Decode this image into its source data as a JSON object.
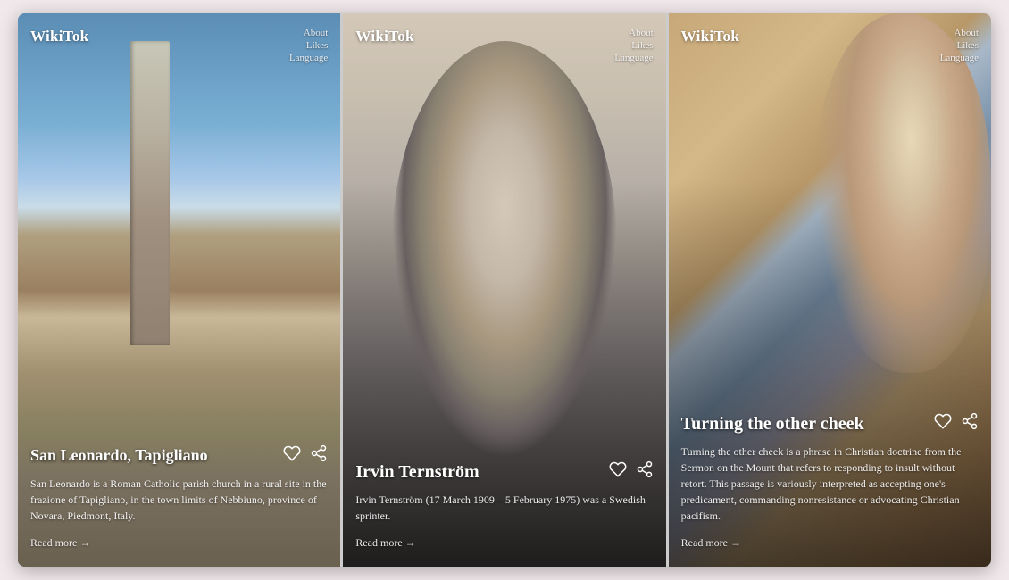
{
  "brand": "WikiTok",
  "nav": [
    "About",
    "Likes",
    "Language"
  ],
  "cards": [
    {
      "id": "card-1",
      "title": "San Leonardo, Tapigliano",
      "description": "San Leonardo is a Roman Catholic parish church in a rural site in the frazione of Tapigliano, in the town limits of Nebbiuno, province of Novara, Piedmont, Italy.",
      "read_more": "Read more →"
    },
    {
      "id": "card-2",
      "title": "Irvin Ternström",
      "description": "Irvin Ternström (17 March 1909 – 5 February 1975) was a Swedish sprinter.",
      "read_more": "Read more →"
    },
    {
      "id": "card-3",
      "title": "Turning the other cheek",
      "description": "Turning the other cheek is a phrase in Christian doctrine from the Sermon on the Mount that refers to responding to insult without retort. This passage is variously interpreted as accepting one's predicament, commanding nonresistance or advocating Christian pacifism.",
      "read_more": "Read more →"
    }
  ]
}
